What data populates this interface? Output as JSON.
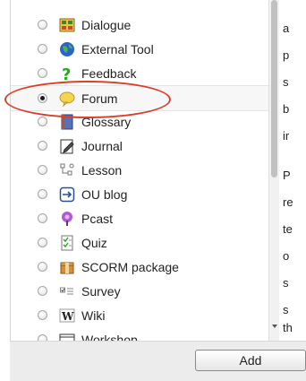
{
  "modules": [
    {
      "label": "Dialogue",
      "icon": "dialogue-icon",
      "selected": false
    },
    {
      "label": "External Tool",
      "icon": "globe-icon",
      "selected": false
    },
    {
      "label": "Feedback",
      "icon": "question-mark-icon",
      "selected": false
    },
    {
      "label": "Forum",
      "icon": "speech-bubble-icon",
      "selected": true
    },
    {
      "label": "Glossary",
      "icon": "book-icon",
      "selected": false
    },
    {
      "label": "Journal",
      "icon": "journal-pencil-icon",
      "selected": false
    },
    {
      "label": "Lesson",
      "icon": "flowchart-icon",
      "selected": false
    },
    {
      "label": "OU blog",
      "icon": "arrow-box-icon",
      "selected": false
    },
    {
      "label": "Pcast",
      "icon": "microphone-icon",
      "selected": false
    },
    {
      "label": "Quiz",
      "icon": "checklist-icon",
      "selected": false
    },
    {
      "label": "SCORM package",
      "icon": "package-icon",
      "selected": false
    },
    {
      "label": "Survey",
      "icon": "survey-icon",
      "selected": false
    },
    {
      "label": "Wiki",
      "icon": "wiki-w-icon",
      "selected": false
    },
    {
      "label": "Workshop",
      "icon": "workshop-icon",
      "selected": false
    }
  ],
  "footer": {
    "add_label": "Add"
  },
  "side_text": [
    "a",
    "p",
    "s",
    "b",
    "ir",
    "P",
    "re",
    "te",
    "o",
    "s",
    "s",
    "th"
  ],
  "colors": {
    "annotation": "#d9402b",
    "forum_icon": "#f3d54e",
    "feedback_icon": "#26a51f"
  }
}
